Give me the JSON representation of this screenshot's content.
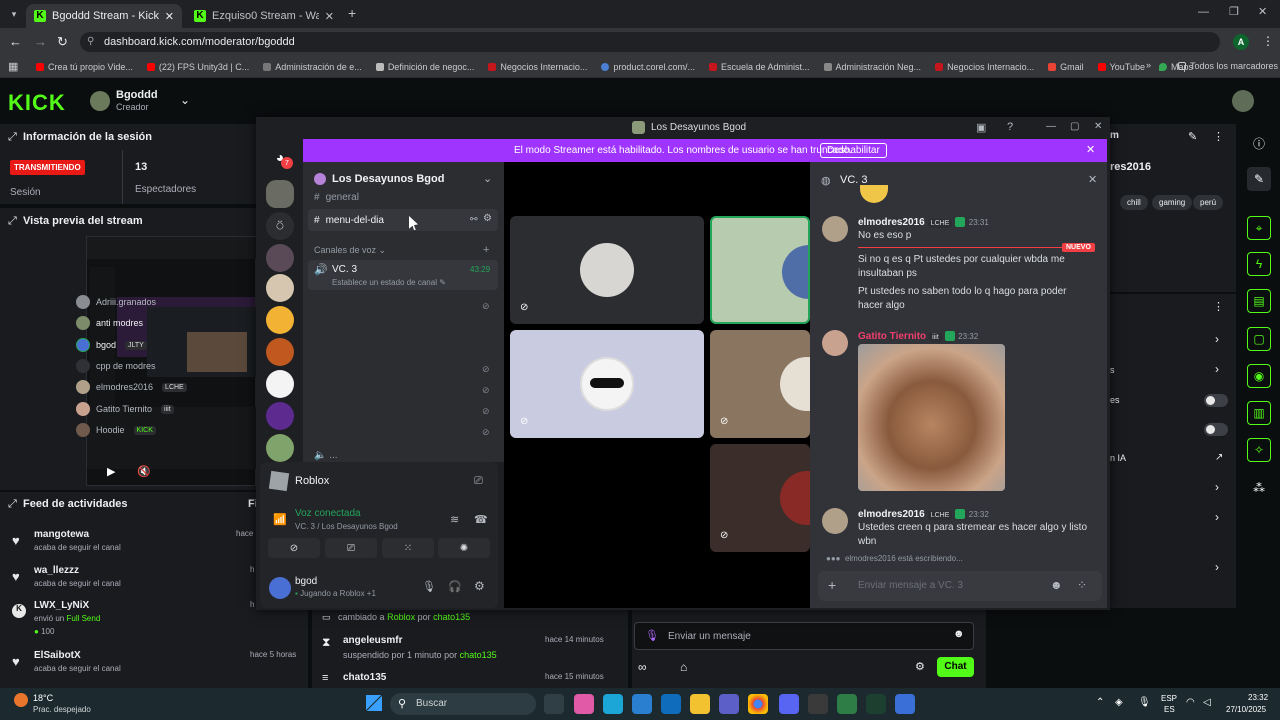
{
  "browser": {
    "tabs": [
      {
        "title": "Bgoddd Stream - Kick Dashbo"
      },
      {
        "title": "Ezquiso0 Stream - Watch Live o"
      }
    ],
    "url": "dashboard.kick.com/moderator/bgoddd",
    "profile_initial": "A",
    "bookmarks": [
      "Crea tú propio Vide...",
      "(22) FPS Unity3d | C...",
      "Administración de e...",
      "Definición de negoc...",
      "Negocios Internacio...",
      "product.corel.com/...",
      "Escuela de Administ...",
      "Administración Neg...",
      "Negocios Internacio...",
      "Gmail",
      "YouTube",
      "Maps"
    ],
    "bookmarks_folder": "Todos los marcadores"
  },
  "kick": {
    "logo": "KICK",
    "channel_name": "Bgoddd",
    "channel_role": "Creador",
    "session": {
      "title": "Información de la sesión",
      "status": "TRANSMITIENDO",
      "status_label": "Sesión",
      "viewers": "13",
      "viewers_label": "Espectadores"
    },
    "preview_title": "Vista previa del stream",
    "activity": {
      "title": "Feed de actividades",
      "filter": "Fi",
      "items": [
        {
          "name": "mangotewa",
          "text": "acaba de seguir el canal",
          "time": "hace"
        },
        {
          "name": "wa_llezzz",
          "text": "acaba de seguir el canal",
          "time": "h"
        },
        {
          "name": "LWX_LyNiX",
          "text": "envió un",
          "highlight": "Full Send",
          "extra": "100",
          "time": "h"
        },
        {
          "name": "ElSaibotX",
          "text": "acaba de seguir el canal",
          "time": "hace 5 horas"
        }
      ]
    },
    "modlog": [
      {
        "text": "cambiado a",
        "game": "Roblox",
        "by": "por",
        "user": "chato135",
        "time": ""
      },
      {
        "name": "angeleusmfr",
        "text": "suspendido por 1 minuto por",
        "user": "chato135",
        "time": "hace 14 minutos"
      },
      {
        "name": "chato135",
        "time": "hace 15 minutos"
      }
    ],
    "chat_input_placeholder": "Enviar un mensaje",
    "chat_button": "Chat",
    "right_panel": {
      "username": "res2016",
      "tags": [
        "chill",
        "gaming",
        "perú"
      ],
      "ia_label": "n IA",
      "s_label": "s",
      "es_label": "es"
    },
    "accent_color": "#53fc18"
  },
  "discord": {
    "window_title": "Los Desayunos Bgod",
    "streamer_banner": "El modo Streamer está habilitado. Los nombres de usuario se han truncado.",
    "disable_button": "Deshabilitar",
    "server_name": "Los Desayunos Bgod",
    "server_badge": "7",
    "channels": [
      "general",
      "menu-del-dia"
    ],
    "voice_category": "Canales de voz",
    "voice_channel": {
      "name": "VC. 3",
      "time": "43:29",
      "status": "Establece un estado de canal"
    },
    "voice_users": [
      {
        "name": "Adriii.granados",
        "tag": ""
      },
      {
        "name": "anti modres",
        "tag": ""
      },
      {
        "name": "bgod",
        "tag": "JLTY"
      },
      {
        "name": "cpp de modres",
        "tag": ""
      },
      {
        "name": "elmodres2016",
        "tag": "LCHE"
      },
      {
        "name": "Gatito Tiernito",
        "tag": "iiit"
      },
      {
        "name": "Hoodie",
        "tag": "KICK"
      }
    ],
    "more_users": "...",
    "activity_card": {
      "game": "Roblox"
    },
    "voice_connected": {
      "label": "Voz conectada",
      "detail": "VC. 3 / Los Desayunos Bgod"
    },
    "user": {
      "name": "bgod",
      "status": "Jugando a Roblox +1"
    },
    "chat": {
      "channel": "VC. 3",
      "new_label": "NUEVO",
      "messages": [
        {
          "user": "elmodres2016",
          "tag": "LCHE",
          "time": "23:31",
          "lines": [
            "No es eso p"
          ]
        },
        {
          "user": "",
          "lines": [
            "Si no q es q Pt ustedes por cualquier wbda me insultaban ps"
          ]
        },
        {
          "user": "",
          "lines": [
            "Pt ustedes no saben todo lo q hago para poder hacer algo"
          ]
        },
        {
          "user": "Gatito Tiernito",
          "tag": "iiit",
          "time": "23:32",
          "lines": []
        },
        {
          "user": "elmodres2016",
          "tag": "LCHE",
          "time": "23:32",
          "lines": [
            "Ustedes creen q para stremear es hacer algo y listo wbn"
          ]
        }
      ],
      "typing": "elmodres2016 está escribiendo...",
      "input_placeholder": "Enviar mensaje a VC. 3"
    }
  },
  "taskbar": {
    "weather_temp": "18°C",
    "weather_desc": "Prac. despejado",
    "search": "Buscar",
    "lang1": "ESP",
    "lang2": "ES",
    "time": "23:32",
    "date": "27/10/2025"
  }
}
